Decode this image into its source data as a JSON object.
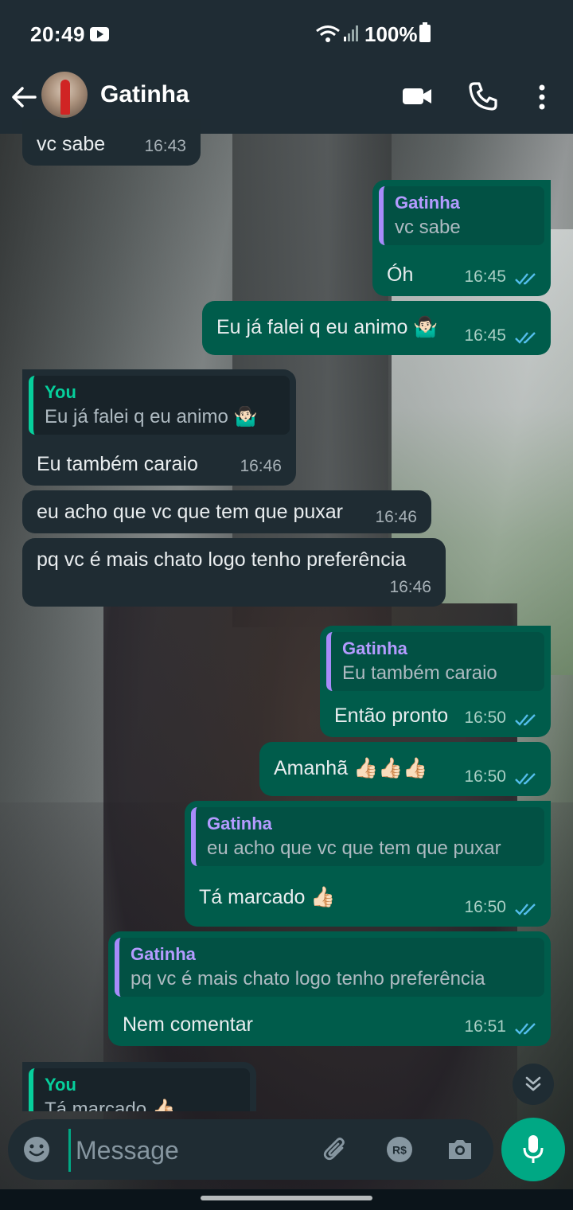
{
  "status": {
    "time": "20:49",
    "battery": "100%"
  },
  "header": {
    "contact_name": "Gatinha"
  },
  "messages": [
    {
      "dir": "in",
      "text": "vc sabe",
      "time": "16:43"
    },
    {
      "dir": "out",
      "quote_author": "Gatinha",
      "quote_text": "vc sabe",
      "text": "Óh",
      "time": "16:45"
    },
    {
      "dir": "out",
      "text": "Eu já falei q eu animo 🤷🏻‍♂️",
      "time": "16:45"
    },
    {
      "dir": "in",
      "quote_author": "You",
      "quote_text": "Eu já falei q eu animo 🤷🏻‍♂️",
      "text": "Eu também caraio",
      "time": "16:46"
    },
    {
      "dir": "in",
      "text": "eu acho que vc que tem que puxar",
      "time": "16:46"
    },
    {
      "dir": "in",
      "text": "pq  vc é mais chato logo tenho preferência",
      "time": "16:46"
    },
    {
      "dir": "out",
      "quote_author": "Gatinha",
      "quote_text": "Eu também caraio",
      "text": "Então pronto",
      "time": "16:50"
    },
    {
      "dir": "out",
      "text": "Amanhã 👍🏻👍🏻👍🏻",
      "time": "16:50"
    },
    {
      "dir": "out",
      "quote_author": "Gatinha",
      "quote_text": "eu acho que vc que tem que puxar",
      "text": "Tá marcado 👍🏻",
      "time": "16:50"
    },
    {
      "dir": "out",
      "quote_author": "Gatinha",
      "quote_text": "pq  vc é mais chato logo tenho preferência",
      "text": "Nem comentar",
      "time": "16:51"
    },
    {
      "dir": "in",
      "quote_author": "You",
      "quote_text": "Tá marcado 👍🏻"
    }
  ],
  "composer": {
    "placeholder": "Message"
  },
  "icons": [
    "youtube-icon",
    "wifi-icon",
    "signal-icon",
    "battery-icon",
    "back-arrow-icon",
    "video-call-icon",
    "phone-icon",
    "more-vert-icon",
    "read-ticks-icon",
    "chevron-double-down-icon",
    "emoji-icon",
    "attach-icon",
    "payment-icon",
    "camera-icon",
    "mic-icon"
  ],
  "colors": {
    "bar": "#1f2c34",
    "incoming": "#1f2c33",
    "outgoing": "#005c4b",
    "accent": "#00a884",
    "read_ticks": "#53bdeb"
  }
}
